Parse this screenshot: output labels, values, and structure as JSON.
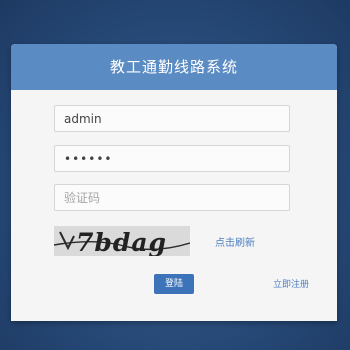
{
  "login": {
    "title": "教工通勤线路系统",
    "username_value": "admin",
    "password_value": "••••••",
    "captcha_placeholder": "验证码",
    "captcha_text": "7bdag",
    "refresh_label": "点击刷新",
    "login_button": "登陆",
    "register_link": "立即注册"
  },
  "colors": {
    "background": "#274a78",
    "header": "#5a8bc2",
    "button": "#3d73b8",
    "link": "#4d7fbf"
  }
}
